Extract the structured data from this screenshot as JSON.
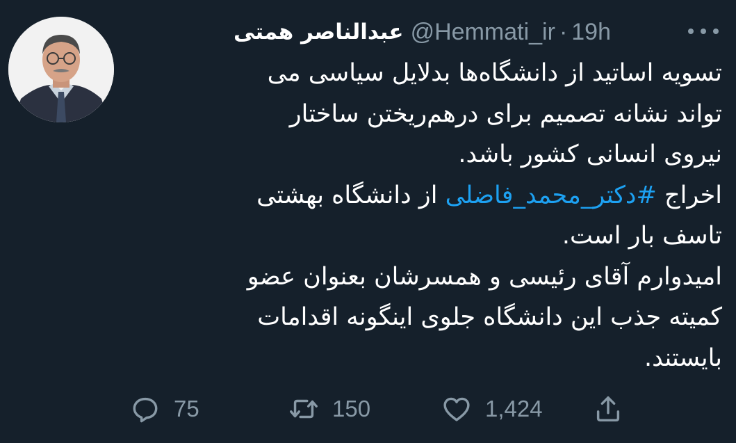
{
  "author": {
    "name": "عبدالناصر همتی",
    "handle": "@Hemmati_ir",
    "separator": "·",
    "time": "19h"
  },
  "avatar_icon": "profile-photo",
  "tweet": {
    "line1": "تسویه اساتید از دانشگاه‌ها بدلایل سیاسی می",
    "line2": "تواند نشانه تصمیم برای درهم‌ریختن ساختار",
    "line3": "نیروی انسانی کشور باشد.",
    "line4_before": "اخراج",
    "hashtag": "#دکتر_محمد_فاضلی",
    "line4_after": "از دانشگاه بهشتی",
    "line5": "تاسف بار است.",
    "line6": "امیدوارم آقای رئیسی و همسرشان بعنوان عضو",
    "line7": "کمیته جذب این دانشگاه جلوی اینگونه اقدامات",
    "line8": "بایستند."
  },
  "actions": {
    "replies": "75",
    "retweets": "150",
    "likes": "1,424"
  },
  "colors": {
    "background": "#15202b",
    "text": "#ffffff",
    "muted": "#8899a6",
    "link": "#1da1f2"
  },
  "icons": [
    "reply-icon",
    "retweet-icon",
    "like-icon",
    "share-icon",
    "more-options-icon"
  ]
}
